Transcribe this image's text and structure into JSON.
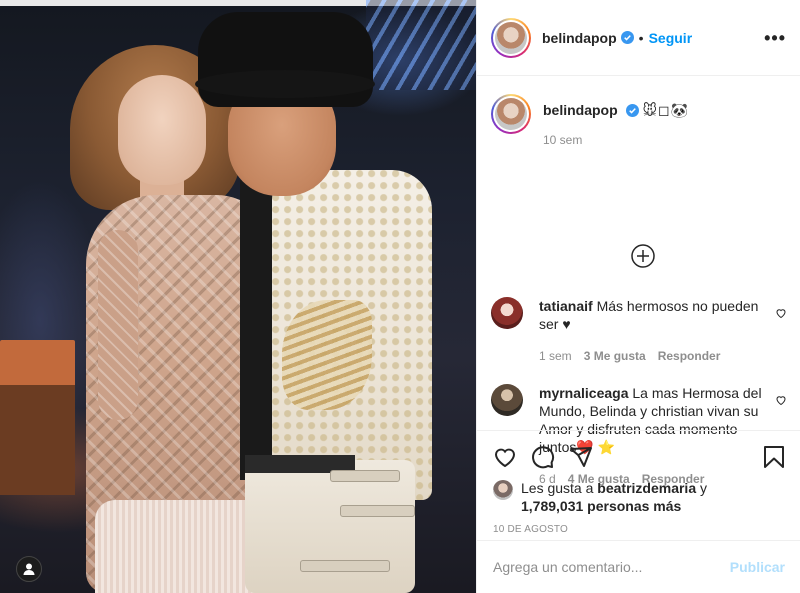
{
  "post": {
    "author": "belindapop",
    "follow_label": "Seguir",
    "separator": "•",
    "more_label": "•••"
  },
  "caption": {
    "username": "belindapop",
    "emojis": "🐭◻🐼",
    "time": "10 sem"
  },
  "comments": [
    {
      "username": "tatianaif",
      "text": "Más hermosos no pueden ser ♥",
      "time": "1 sem",
      "likes": "3 Me gusta",
      "reply_label": "Responder"
    },
    {
      "username": "myrnaliceaga",
      "text": "La mas Hermosa del Mundo, Belinda y christian vivan su Amor y disfruten cada momento juntos❤️ ⭐",
      "time": "6 d",
      "likes": "4 Me gusta",
      "reply_label": "Responder"
    }
  ],
  "likes": {
    "prefix": "Les gusta a",
    "liker": "beatrizdemaria",
    "conjunction": "y",
    "others": "1,789,031 personas más"
  },
  "date": "10 DE AGOSTO",
  "add_comment": {
    "placeholder": "Agrega un comentario...",
    "publish_label": "Publicar"
  },
  "colors": {
    "link_blue": "#0095f6",
    "publish_disabled": "#b2dffc",
    "muted": "#8e8e8e"
  },
  "icons": [
    "verified-icon",
    "load-more-icon",
    "heart-icon",
    "comment-icon",
    "share-icon",
    "bookmark-icon",
    "user-tag-icon"
  ]
}
